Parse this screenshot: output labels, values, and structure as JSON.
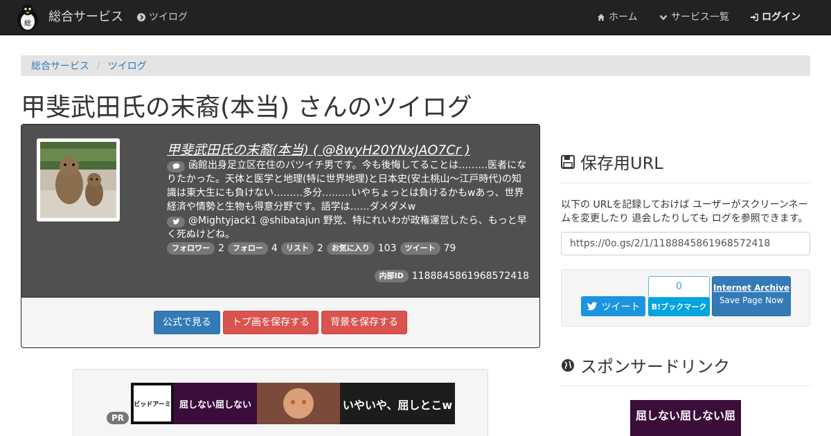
{
  "nav": {
    "brand": "総合サービス",
    "tweetlog": "ツイログ",
    "home": "ホーム",
    "services": "サービス一覧",
    "login": "ログイン"
  },
  "breadcrumb": [
    "総合サービス",
    "ツイログ"
  ],
  "page_title": "甲斐武田氏の末裔(本当) さんのツイログ",
  "profile": {
    "name": "甲斐武田氏の末裔(本当) ( @8wyH20YNxJAO7Cr )",
    "bio": "函館出身足立区在住のバツイチ男です。今も後悔してることは………医者になりたかった。天体と医学と地理(特に世界地理)と日本史(安土桃山～江戸時代)の知識は東大生にも負けない………多分………いやちょっとは負けるかもwあっ、世界経済や情勢と生物も得意分野です。語学は……ダメダメw",
    "last_tweet": "@Mightyjack1 @shibatajun 野党、特にれいわが政権運営したら、もっと早く死ぬけどね。",
    "stats": [
      {
        "label": "フォロワー",
        "value": "2"
      },
      {
        "label": "フォロー",
        "value": "4"
      },
      {
        "label": "リスト",
        "value": "2"
      },
      {
        "label": "お気に入り",
        "value": "103"
      },
      {
        "label": "ツイート",
        "value": "79"
      }
    ],
    "internal_id_label": "内部ID",
    "internal_id": "1188845861968572418"
  },
  "actions": {
    "view_official": "公式で見る",
    "save_avatar": "トプ画を保存する",
    "save_background": "背景を保存する"
  },
  "pr": {
    "badge": "PR",
    "banner_text_1": "ビビッドアーミー",
    "banner_text_2": "いやいや、屈しとこw",
    "banner_text_3": "屈しない屈しない"
  },
  "sidebar": {
    "save_url_heading": "保存用URL",
    "save_url_desc": "以下の URLを記録しておけば ユーザーがスクリーンネームを変更したり 退会したりしても ログを参照できます。",
    "save_url": "https://0o.gs/2/1/1188845861968572418",
    "tweet_button": "ツイート",
    "hatena_count": "0",
    "hatena_button": "B!ブックマーク",
    "archive_title": "Internet Archive",
    "archive_sub": "Save Page Now",
    "sponsored_heading": "スポンサードリンク",
    "ad_text": "屈しない屈しない屈"
  },
  "colors": {
    "navbar": "#222222",
    "link": "#337ab7",
    "primary": "#337ab7",
    "danger": "#d9534f",
    "profile_bg": "#505050",
    "twitter": "#1b95e0",
    "hatena": "#00a4de"
  },
  "icons": {
    "brand": "penguin-logo-icon",
    "tweetlog": "chevron-circle-right-icon",
    "home": "home-icon",
    "services": "chevron-down-icon",
    "login": "sign-in-icon",
    "bio": "comment-icon",
    "last_tweet": "twitter-icon",
    "save_url": "floppy-disk-icon",
    "sponsored": "globe-icon"
  }
}
